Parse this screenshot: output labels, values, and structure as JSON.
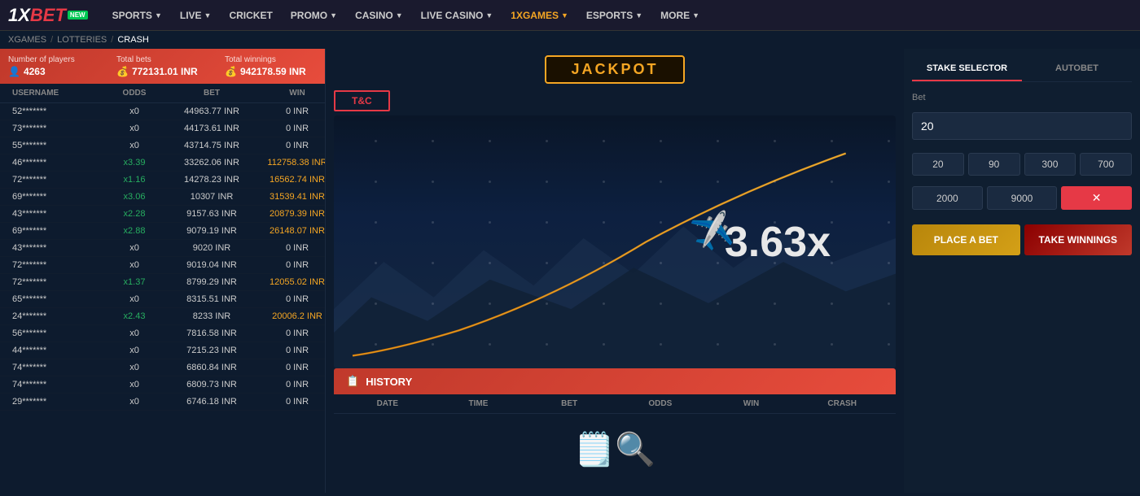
{
  "brand": {
    "name": "1XBET",
    "new_badge": "NEW"
  },
  "navbar": {
    "items": [
      {
        "label": "SPORTS",
        "has_dropdown": true,
        "active": false
      },
      {
        "label": "LIVE",
        "has_dropdown": true,
        "active": false
      },
      {
        "label": "CRICKET",
        "has_dropdown": false,
        "active": false
      },
      {
        "label": "PROMO",
        "has_dropdown": true,
        "active": false
      },
      {
        "label": "CASINO",
        "has_dropdown": true,
        "active": false
      },
      {
        "label": "LIVE CASINO",
        "has_dropdown": true,
        "active": false
      },
      {
        "label": "1XGAMES",
        "has_dropdown": true,
        "active": true
      },
      {
        "label": "ESPORTS",
        "has_dropdown": true,
        "active": false
      },
      {
        "label": "MORE",
        "has_dropdown": true,
        "active": false
      }
    ]
  },
  "breadcrumb": {
    "items": [
      "XGAMES",
      "LOTTERIES",
      "CRASH"
    ]
  },
  "stats": {
    "players_label": "Number of players",
    "players_value": "4263",
    "total_bets_label": "Total bets",
    "total_bets_value": "772131.01 INR",
    "total_winnings_label": "Total winnings",
    "total_winnings_value": "942178.59 INR"
  },
  "table": {
    "headers": [
      "USERNAME",
      "ODDS",
      "BET",
      "WIN"
    ],
    "rows": [
      {
        "username": "52*******",
        "odds": "x0",
        "bet": "44963.77 INR",
        "win": "0 INR",
        "win_positive": false
      },
      {
        "username": "73*******",
        "odds": "x0",
        "bet": "44173.61 INR",
        "win": "0 INR",
        "win_positive": false
      },
      {
        "username": "55*******",
        "odds": "x0",
        "bet": "43714.75 INR",
        "win": "0 INR",
        "win_positive": false
      },
      {
        "username": "46*******",
        "odds": "x3.39",
        "bet": "33262.06 INR",
        "win": "112758.38 INR",
        "win_positive": true
      },
      {
        "username": "72*******",
        "odds": "x1.16",
        "bet": "14278.23 INR",
        "win": "16562.74 INR",
        "win_positive": true
      },
      {
        "username": "69*******",
        "odds": "x3.06",
        "bet": "10307 INR",
        "win": "31539.41 INR",
        "win_positive": true
      },
      {
        "username": "43*******",
        "odds": "x2.28",
        "bet": "9157.63 INR",
        "win": "20879.39 INR",
        "win_positive": true
      },
      {
        "username": "69*******",
        "odds": "x2.88",
        "bet": "9079.19 INR",
        "win": "26148.07 INR",
        "win_positive": true
      },
      {
        "username": "43*******",
        "odds": "x0",
        "bet": "9020 INR",
        "win": "0 INR",
        "win_positive": false
      },
      {
        "username": "72*******",
        "odds": "x0",
        "bet": "9019.04 INR",
        "win": "0 INR",
        "win_positive": false
      },
      {
        "username": "72*******",
        "odds": "x1.37",
        "bet": "8799.29 INR",
        "win": "12055.02 INR",
        "win_positive": true
      },
      {
        "username": "65*******",
        "odds": "x0",
        "bet": "8315.51 INR",
        "win": "0 INR",
        "win_positive": false
      },
      {
        "username": "24*******",
        "odds": "x2.43",
        "bet": "8233 INR",
        "win": "20006.2 INR",
        "win_positive": true
      },
      {
        "username": "56*******",
        "odds": "x0",
        "bet": "7816.58 INR",
        "win": "0 INR",
        "win_positive": false
      },
      {
        "username": "44*******",
        "odds": "x0",
        "bet": "7215.23 INR",
        "win": "0 INR",
        "win_positive": false
      },
      {
        "username": "74*******",
        "odds": "x0",
        "bet": "6860.84 INR",
        "win": "0 INR",
        "win_positive": false
      },
      {
        "username": "74*******",
        "odds": "x0",
        "bet": "6809.73 INR",
        "win": "0 INR",
        "win_positive": false
      },
      {
        "username": "29*******",
        "odds": "x0",
        "bet": "6746.18 INR",
        "win": "0 INR",
        "win_positive": false
      }
    ]
  },
  "game": {
    "jackpot_label": "JACKPOT",
    "tc_button": "T&C",
    "multiplier": "3.63x",
    "history_title": "HISTORY",
    "history_cols": [
      "DATE",
      "TIME",
      "BET",
      "ODDS",
      "WIN",
      "CRASH"
    ]
  },
  "right_panel": {
    "tab_stake": "STAKE SELECTOR",
    "tab_autobet": "AUTOBET",
    "bet_label": "Bet",
    "bet_value": "20",
    "quick_bets": [
      "20",
      "90",
      "300",
      "700"
    ],
    "quick_bets_row2": [
      "2000",
      "9000"
    ],
    "place_bet_label": "PLACE A BET",
    "take_winnings_label": "TAKE WINNINGS"
  }
}
